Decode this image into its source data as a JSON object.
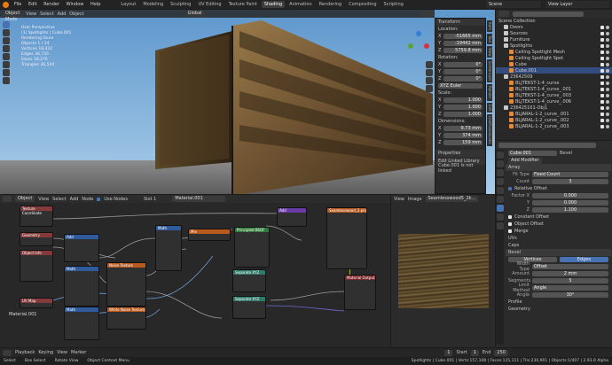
{
  "topbar": {
    "menus": [
      "File",
      "Edit",
      "Render",
      "Window",
      "Help"
    ],
    "workspaces": [
      "Layout",
      "Modeling",
      "Sculpting",
      "UV Editing",
      "Texture Paint",
      "Shading",
      "Animation",
      "Rendering",
      "Compositing",
      "Scripting"
    ],
    "active_workspace": "Shading",
    "scene_label": "Scene",
    "view_layer_label": "View Layer"
  },
  "viewport": {
    "mode": "Object Mode",
    "menus": [
      "View",
      "Select",
      "Add",
      "Object"
    ],
    "orientation": "Global",
    "overlay_info": [
      "User Perspective",
      "(1) Spotlights | Cube.001",
      "Rendering Done",
      "Objects   1 / 14",
      "Vertices  18,432",
      "Edges     36,735",
      "Faces     18,276",
      "Triangles 36,544"
    ],
    "sidebar_tabs": [
      "Item",
      "Tool",
      "View",
      "Screencast",
      "Render",
      "Edit",
      "LineFusionLinks"
    ],
    "transform_title": "Transform",
    "location_label": "Location:",
    "location": [
      "-51665 mm",
      "-19442 mm",
      "5759.8 mm"
    ],
    "rotation_label": "Rotation:",
    "rotation": [
      "0°",
      "0°",
      "0°"
    ],
    "rotation_mode": "XYZ Euler",
    "scale_label": "Scale:",
    "scale": [
      "1.000",
      "1.000",
      "1.000"
    ],
    "dimensions_label": "Dimensions:",
    "dimensions": [
      "9.73 mm",
      "374 mm",
      "159 mm"
    ],
    "axes": [
      "X",
      "Y",
      "Z"
    ],
    "properties_title": "Properties",
    "library_title": "Edit Linked Library",
    "library_status": "Cube.001 is not linked"
  },
  "node_editor": {
    "header_items": [
      "Object",
      "View",
      "Select",
      "Add",
      "Node"
    ],
    "use_nodes": "Use Nodes",
    "slot": "Slot 1",
    "material": "Material.001",
    "material_label": "Material.001",
    "nodes": [
      {
        "title": "Texture Coordinate",
        "color": "#823a3a"
      },
      {
        "title": "Geometry",
        "color": "#823a3a"
      },
      {
        "title": "Object Info",
        "color": "#823a3a"
      },
      {
        "title": "UV Map",
        "color": "#823a3a"
      },
      {
        "title": "Add",
        "color": "#2f5a9c"
      },
      {
        "title": "Math",
        "color": "#2f5a9c"
      },
      {
        "title": "Noise Texture",
        "color": "#b85a20"
      },
      {
        "title": "Math",
        "color": "#2f5a9c"
      },
      {
        "title": "Math",
        "color": "#2f5a9c"
      },
      {
        "title": "White Noise Texture",
        "color": "#b85a20"
      },
      {
        "title": "Mix",
        "color": "#b85a20"
      },
      {
        "title": "Separate XYZ",
        "color": "#2f7a6a"
      },
      {
        "title": "Separate XYZ",
        "color": "#2f7a6a"
      },
      {
        "title": "Add",
        "color": "#6a3aa8"
      },
      {
        "title": "Seamlesswood_2.png",
        "color": "#b85a20"
      },
      {
        "title": "Principled BSDF",
        "color": "#2f7a3a"
      },
      {
        "title": "Material Output",
        "color": "#7a2a2a"
      }
    ]
  },
  "image_editor": {
    "menus": [
      "View",
      "Image"
    ],
    "image_name": "Seamlesswood5_2k..."
  },
  "outliner": {
    "title": "Scene Collection",
    "items": [
      {
        "label": "Doors",
        "depth": 1
      },
      {
        "label": "Sources",
        "depth": 1
      },
      {
        "label": "Furniture",
        "depth": 1
      },
      {
        "label": "Spotlights",
        "depth": 1
      },
      {
        "label": "Ceiling Spotlight Mesh",
        "depth": 2
      },
      {
        "label": "Ceiling Spotlight Spot",
        "depth": 2
      },
      {
        "label": "Cube",
        "depth": 2
      },
      {
        "label": "Cube.001",
        "depth": 2,
        "selected": true
      },
      {
        "label": "23642509",
        "depth": 1
      },
      {
        "label": "BLJTEKST-1-4_curve",
        "depth": 2
      },
      {
        "label": "BLJTEKST-1-4_curve_.001",
        "depth": 2
      },
      {
        "label": "BLJTEKST-1-4_curve_.003",
        "depth": 2
      },
      {
        "label": "BLJTEKST-1-4_curve_.006",
        "depth": 2
      },
      {
        "label": "236425101-Obj1",
        "depth": 1
      },
      {
        "label": "BLJARAL-1-2_curve_.001",
        "depth": 2
      },
      {
        "label": "BLJARAL-1-2_curve_.002",
        "depth": 2
      },
      {
        "label": "BLJARAL-1-2_curve_.003",
        "depth": 2
      }
    ]
  },
  "properties": {
    "object_name": "Cube.001",
    "modifier_name": "Bevel",
    "add_modifier": "Add Modifier",
    "array_title": "Array",
    "fit_type_label": "Fit Type",
    "fit_type": "Fixed Count",
    "count_label": "Count",
    "count": "3",
    "relative_offset": "Relative Offset",
    "factor_x_label": "Factor X",
    "factor_y_label": "Y",
    "factor_z_label": "Z",
    "factor_x": "0.000",
    "factor_y": "0.000",
    "factor_z": "1.100",
    "constant_offset": "Constant Offset",
    "object_offset": "Object Offset",
    "merge": "Merge",
    "uvs": "UVs",
    "caps": "Caps",
    "bevel_title": "Bevel",
    "vertices_tab": "Vertices",
    "edges_tab": "Edges",
    "width_type_label": "Width Type",
    "width_type": "Offset",
    "amount_label": "Amount",
    "amount": "2 mm",
    "segments_label": "Segments",
    "segments": "5",
    "limit_method_label": "Limit Method",
    "limit_method": "Angle",
    "angle_label": "Angle",
    "angle": "30°",
    "profile": "Profile",
    "geometry": "Geometry"
  },
  "timeline": {
    "items": [
      "Playback",
      "Keying",
      "View",
      "Marker"
    ],
    "frame": "1",
    "start_label": "Start",
    "start": "1",
    "end_label": "End",
    "end": "250"
  },
  "statusbar": {
    "select": "Select",
    "box_select": "Box Select",
    "rotate_view": "Rotate View",
    "context_menu": "Object Context Menu",
    "stats": "Spotlights | Cube.001 | Verts:157,108 | Faces:115,111 | Tris:230,901 | Objects:1/407 | 2.93.0 Alpha"
  }
}
